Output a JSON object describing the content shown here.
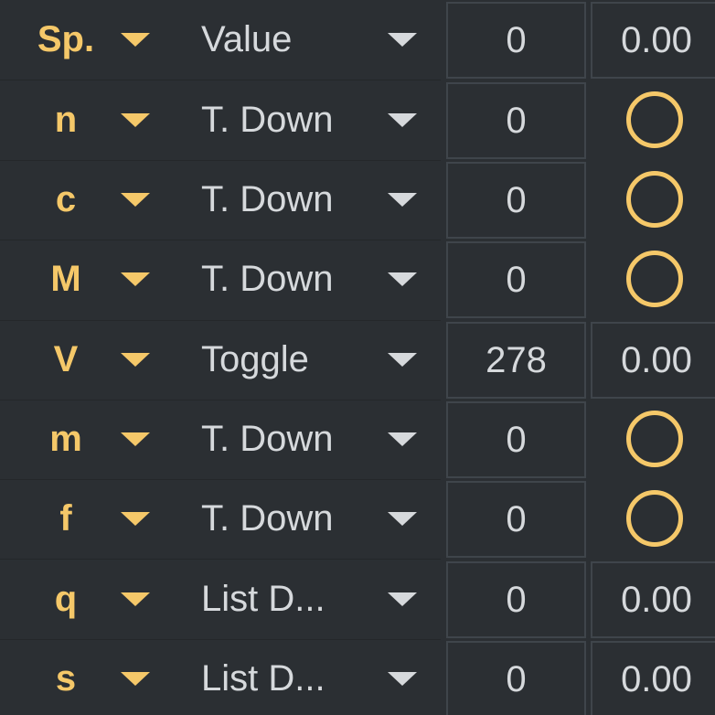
{
  "rows": [
    {
      "key": "Sp.",
      "mode": "Value",
      "number": "0",
      "value": "0.00"
    },
    {
      "key": "n",
      "mode": "T. Down",
      "number": "0",
      "toggle": "off"
    },
    {
      "key": "c",
      "mode": "T. Down",
      "number": "0",
      "toggle": "off"
    },
    {
      "key": "M",
      "mode": "T. Down",
      "number": "0",
      "toggle": "off"
    },
    {
      "key": "V",
      "mode": "Toggle",
      "number": "278",
      "value": "0.00"
    },
    {
      "key": "m",
      "mode": "T. Down",
      "number": "0",
      "toggle": "off"
    },
    {
      "key": "f",
      "mode": "T. Down",
      "number": "0",
      "toggle": "off"
    },
    {
      "key": "q",
      "mode": "List D...",
      "number": "0",
      "value": "0.00"
    },
    {
      "key": "s",
      "mode": "List D...",
      "number": "0",
      "value": "0.00"
    }
  ],
  "colors": {
    "background": "#2b2f33",
    "accent": "#f5c869",
    "text": "#d6d9dc",
    "box_border": "#3f454b"
  },
  "icons": {
    "key_dropdown": "caret-down-icon",
    "mode_dropdown": "caret-down-icon",
    "toggle": "circle-toggle-icon"
  }
}
